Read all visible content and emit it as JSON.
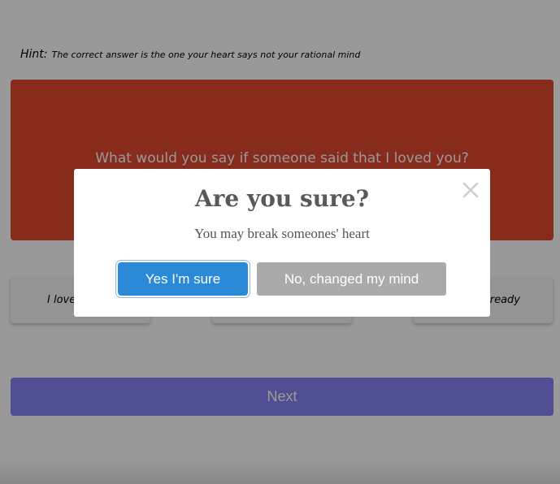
{
  "hint": {
    "label": "Hint:",
    "text": "The correct answer is the one your heart says not your rational mind"
  },
  "question": {
    "text": "What would you say if someone said that I loved you?"
  },
  "options": [
    {
      "label": "I love"
    },
    {
      "label": ""
    },
    {
      "label": "ready"
    }
  ],
  "next": {
    "label": "Next"
  },
  "modal": {
    "title": "Are you sure?",
    "message": "You may break someones' heart",
    "confirm_label": "Yes I'm sure",
    "cancel_label": "No, changed my mind",
    "close_icon": "close-icon"
  },
  "colors": {
    "question_card": "#e14a30",
    "next_button": "#8682f3",
    "confirm_button": "#2b8ad8",
    "cancel_button": "#aaaaaa",
    "overlay": "rgba(0,0,0,0.40)"
  }
}
